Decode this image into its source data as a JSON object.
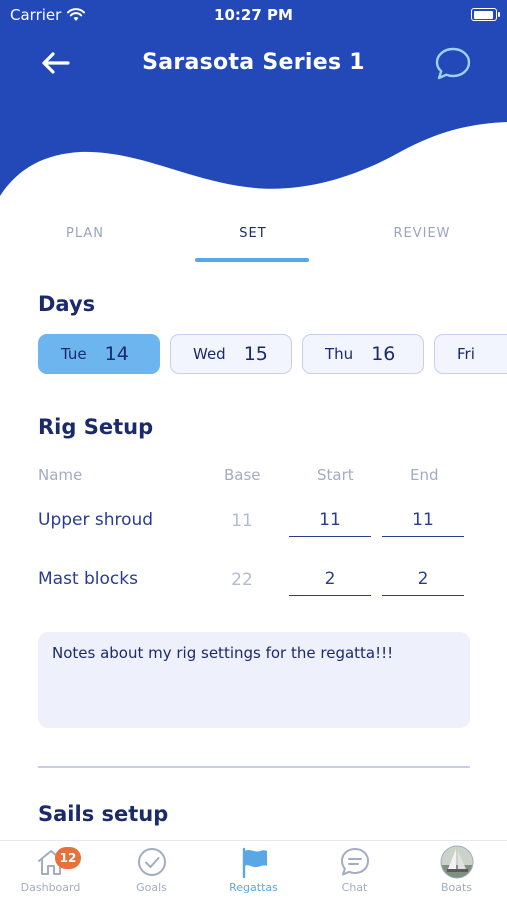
{
  "status_bar": {
    "carrier": "Carrier",
    "time": "10:27 PM"
  },
  "header": {
    "title": "Sarasota Series 1",
    "back_icon": "back-arrow-icon",
    "chat_icon": "chat-bubble-icon",
    "color": "#2249b7"
  },
  "tabs": [
    {
      "label": "PLAN",
      "active": false
    },
    {
      "label": "SET",
      "active": true
    },
    {
      "label": "REVIEW",
      "active": false
    }
  ],
  "days": {
    "title": "Days",
    "items": [
      {
        "day": "Tue",
        "num": "14",
        "selected": true
      },
      {
        "day": "Wed",
        "num": "15",
        "selected": false
      },
      {
        "day": "Thu",
        "num": "16",
        "selected": false
      },
      {
        "day": "Fri",
        "num": "",
        "selected": false
      }
    ]
  },
  "rig": {
    "title": "Rig Setup",
    "columns": [
      "Name",
      "Base",
      "Start",
      "End"
    ],
    "rows": [
      {
        "name": "Upper shroud",
        "base": "11",
        "start": "11",
        "end": "11"
      },
      {
        "name": "Mast blocks",
        "base": "22",
        "start": "2",
        "end": "2"
      }
    ],
    "notes": "Notes about my rig settings for the regatta!!!"
  },
  "sails": {
    "title": "Sails setup"
  },
  "nav": {
    "items": [
      {
        "label": "Dashboard",
        "icon": "home-icon",
        "badge": "12"
      },
      {
        "label": "Goals",
        "icon": "check-circle-icon"
      },
      {
        "label": "Regattas",
        "icon": "flag-icon",
        "active": true
      },
      {
        "label": "Chat",
        "icon": "chat-icon"
      },
      {
        "label": "Boats",
        "icon": "boat-avatar-icon"
      }
    ]
  },
  "colors": {
    "accent": "#5aa7e8",
    "primary": "#2249b7",
    "badge": "#e8703a"
  }
}
